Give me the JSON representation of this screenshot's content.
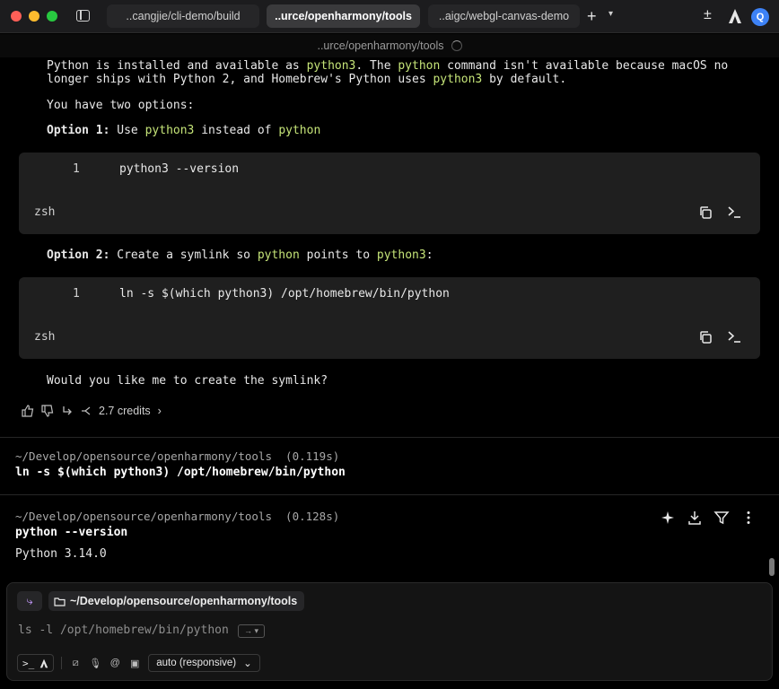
{
  "tabs": [
    {
      "label": "..cangjie/cli-demo/build"
    },
    {
      "label": "..urce/openharmony/tools"
    },
    {
      "label": "..aigc/webgl-canvas-demo"
    }
  ],
  "window": {
    "avatar_initial": "Q",
    "path_title": "..urce/openharmony/tools"
  },
  "answer": {
    "intro_line1_a": "Python is installed and available as ",
    "intro_line1_hl1": "python3",
    "intro_line1_b": ". The ",
    "intro_line1_hl2": "python",
    "intro_line1_c": " command isn't available because macOS no",
    "intro_line2_a": "longer ships with Python 2, and Homebrew's Python uses ",
    "intro_line2_hl": "python3",
    "intro_line2_b": " by default.",
    "options_intro": "You have two options:",
    "option1_label": "Option 1:",
    "option1_a": " Use ",
    "option1_hl1": "python3",
    "option1_b": " instead of ",
    "option1_hl2": "python",
    "option2_label": "Option 2:",
    "option2_a": " Create a symlink so ",
    "option2_hl1": "python",
    "option2_b": " points to ",
    "option2_hl2": "python3",
    "option2_c": ":",
    "closing": "Would you like me to create the symlink?",
    "credits": "2.7 credits"
  },
  "code_blocks": [
    {
      "line_no": "1",
      "code": "python3 --version",
      "lang": "zsh"
    },
    {
      "line_no": "1",
      "code": "ln -s $(which python3) /opt/homebrew/bin/python",
      "lang": "zsh"
    }
  ],
  "terminal_blocks": [
    {
      "cwd": "~/Develop/opensource/openharmony/tools",
      "duration": "(0.119s)",
      "command": "ln -s $(which python3) /opt/homebrew/bin/python",
      "output": ""
    },
    {
      "cwd": "~/Develop/opensource/openharmony/tools",
      "duration": "(0.128s)",
      "command": "python --version",
      "output": "Python 3.14.0"
    }
  ],
  "input": {
    "cwd_chip": "~/Develop/opensource/openharmony/tools",
    "prompt_text": "ls -l /opt/homebrew/bin/python",
    "model": "auto (responsive)"
  },
  "icons": {
    "mode_chip": "return-arrow-icon",
    "tab_add": "plus-icon",
    "tab_menu": "chevron-down-icon",
    "diff": "plus-minus-icon",
    "agent": "agent-logo-icon"
  },
  "colors": {
    "highlight": "#c5e478",
    "avatar": "#3d82f6",
    "agent_accent": "#c79bff"
  }
}
